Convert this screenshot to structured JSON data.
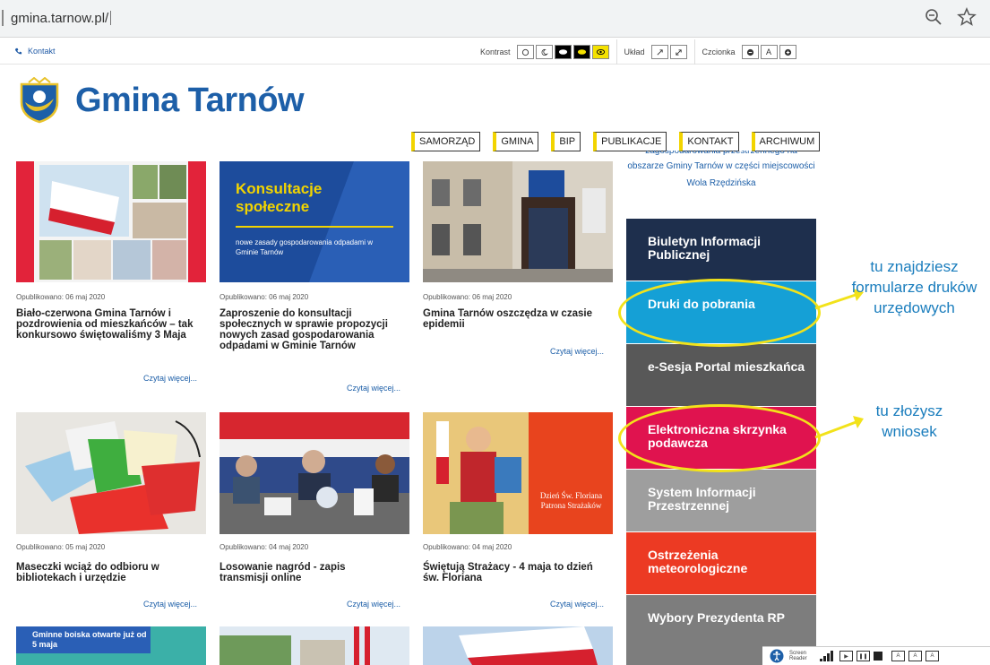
{
  "browser": {
    "url": "gmina.tarnow.pl/"
  },
  "utility_bar": {
    "contact": "Kontakt",
    "kontrast_label": "Kontrast",
    "uklad_label": "Układ",
    "czcionka_label": "Czcionka",
    "font_buttons": [
      "A"
    ]
  },
  "site": {
    "title": "Gmina Tarnów"
  },
  "nav": [
    "SAMORZĄD",
    "GMINA",
    "BIP",
    "PUBLIKACJE",
    "KONTAKT",
    "ARCHIWUM"
  ],
  "articles": [
    {
      "date": "Opublikowano: 06 maj 2020",
      "title": "Biało-czerwona Gmina Tarnów i pozdrowienia od mieszkańców – tak konkursowo świętowaliśmy 3 Maja",
      "more": "Czytaj więcej..."
    },
    {
      "date": "Opublikowano: 06 maj 2020",
      "title": "Zaproszenie do konsultacji społecznych w sprawie propozycji nowych zasad gospodarowania odpadami w Gminie Tarnów",
      "more": "Czytaj więcej..."
    },
    {
      "date": "Opublikowano: 06 maj 2020",
      "title": "Gmina Tarnów oszczędza w czasie epidemii",
      "more": "Czytaj więcej..."
    },
    {
      "date": "Opublikowano: 05 maj 2020",
      "title": "Maseczki wciąż do odbioru w bibliotekach i urzędzie",
      "more": "Czytaj więcej..."
    },
    {
      "date": "Opublikowano: 04 maj 2020",
      "title": "Losowanie nagród - zapis transmisji online",
      "more": "Czytaj więcej..."
    },
    {
      "date": "Opublikowano: 04 maj 2020",
      "title": "Świętują Strażacy - 4 maja to dzień św. Floriana",
      "more": "Czytaj więcej..."
    }
  ],
  "image_texts": {
    "konsultacje_title": "Konsultacje społeczne",
    "konsultacje_sub": "nowe zasady gospodarowania odpadami w Gminie Tarnów",
    "florian": "Dzień Św. Floriana Patrona Strażaków",
    "boiska": "Gminne boiska otwarte już od 5 maja"
  },
  "sidebar": {
    "text_top": "zagospodarowania przestrzennego na",
    "text": "obszarze Gminy Tarnów w części miejscowości Wola Rzędzińska",
    "boxes": [
      {
        "label": "Biuletyn Informacji Publicznej",
        "color": "#1e2f4d"
      },
      {
        "label": "Druki do pobrania",
        "color": "#15a0d6"
      },
      {
        "label": "e-Sesja Portal mieszkańca",
        "color": "#585858"
      },
      {
        "label": "Elektroniczna skrzynka podawcza",
        "color": "#e0134f"
      },
      {
        "label": "System Informacji Przestrzennej",
        "color": "#9e9e9e"
      },
      {
        "label": "Ostrzeżenia meteorologiczne",
        "color": "#ec3a23"
      },
      {
        "label": "Wybory Prezydenta RP",
        "color": "#7d7d7d"
      }
    ]
  },
  "annotations": {
    "note1": "tu znajdziesz formularze druków urzędowych",
    "note2": "tu złożysz wniosek",
    "color": "#f2e21a"
  },
  "screen_reader": {
    "label": "Screen Reader"
  },
  "colors": {
    "brand": "#1d5fa8",
    "nav_accent": "#f2d400"
  }
}
